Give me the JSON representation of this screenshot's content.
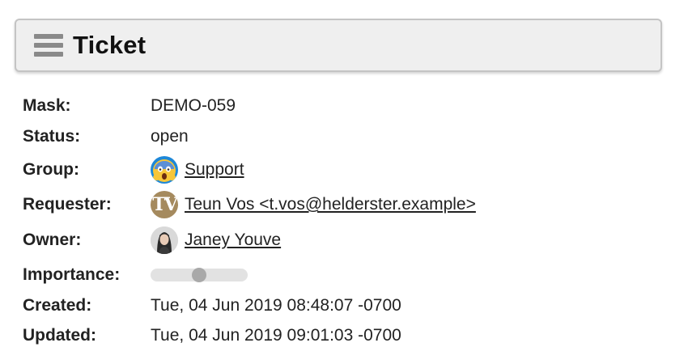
{
  "header": {
    "title": "Ticket"
  },
  "properties": {
    "mask": {
      "label": "Mask:",
      "value": "DEMO-059"
    },
    "status": {
      "label": "Status:",
      "value": "open"
    },
    "group": {
      "label": "Group:",
      "value": "Support",
      "icon": "screaming-face-icon"
    },
    "requester": {
      "label": "Requester:",
      "value": "Teun Vos <t.vos@helderster.example>",
      "avatar_initials": "TV"
    },
    "owner": {
      "label": "Owner:",
      "value": "Janey Youve",
      "icon": "person-avatar-icon"
    },
    "importance": {
      "label": "Importance:",
      "level_fraction": 0.5
    },
    "created": {
      "label": "Created:",
      "value": "Tue, 04 Jun 2019 08:48:07 -0700"
    },
    "updated": {
      "label": "Updated:",
      "value": "Tue, 04 Jun 2019 09:01:03 -0700"
    }
  },
  "colors": {
    "header_bg": "#efefef",
    "group_avatar_bg": "#1e88d8",
    "requester_avatar_bg": "#a58a5e",
    "slider_track": "#e2e2e2",
    "slider_thumb": "#a9a9a9"
  }
}
